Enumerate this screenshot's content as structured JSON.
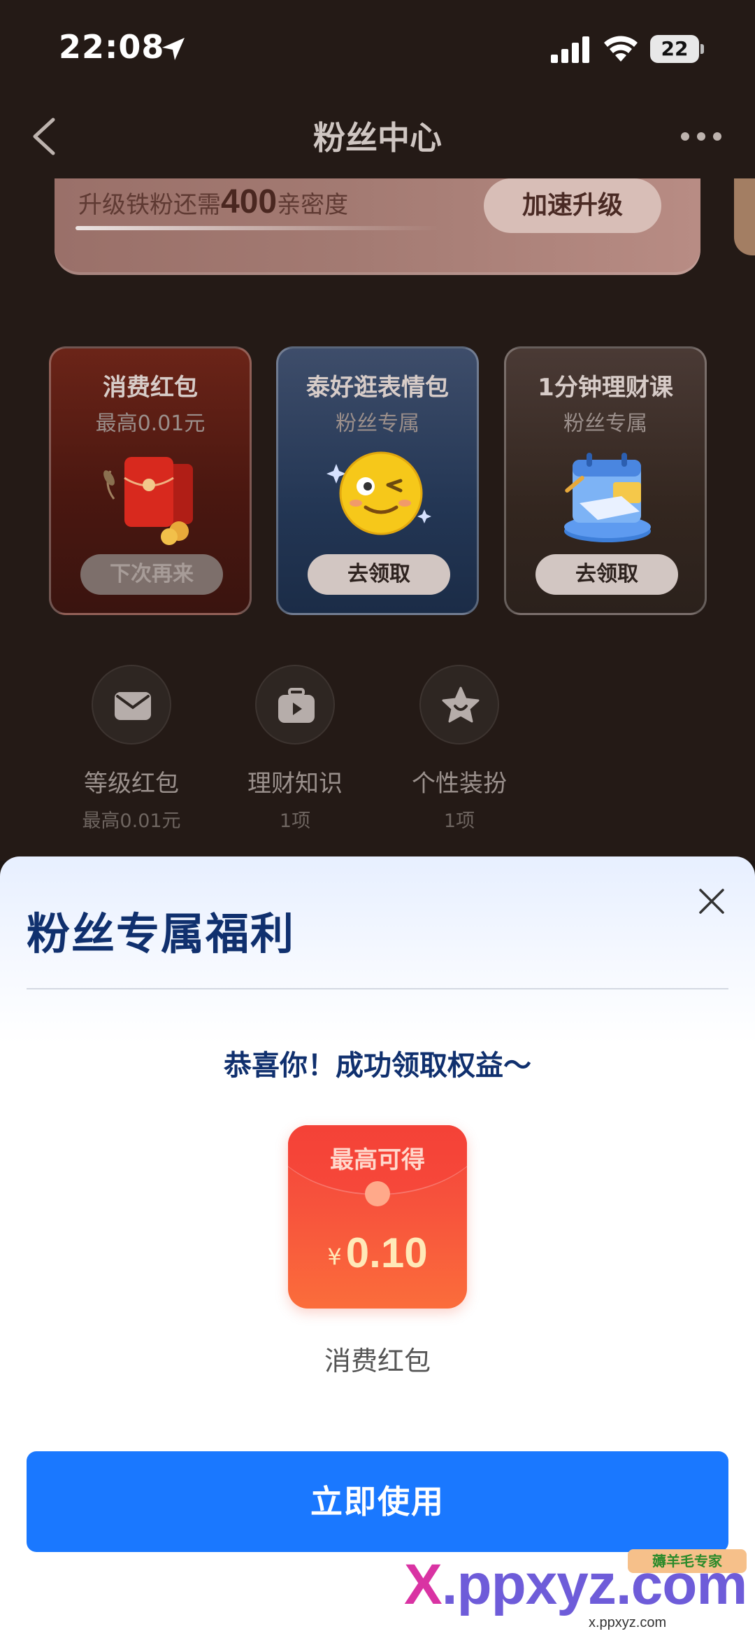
{
  "status_bar": {
    "time": "22:08",
    "battery": "22"
  },
  "nav": {
    "title": "粉丝中心"
  },
  "upgrade": {
    "prefix": "升级铁粉还需",
    "amount": "400",
    "suffix": "亲密度",
    "button": "加速升级"
  },
  "benefits": [
    {
      "title": "消费红包",
      "subtitle": "最高0.01元",
      "button": "下次再来",
      "state": "disabled",
      "icon": "red-envelope-icon"
    },
    {
      "title": "泰好逛表情包",
      "subtitle": "粉丝专属",
      "button": "去领取",
      "state": "active",
      "icon": "wink-emoji-icon"
    },
    {
      "title": "1分钟理财课",
      "subtitle": "粉丝专属",
      "button": "去领取",
      "state": "active",
      "icon": "calendar-course-icon"
    }
  ],
  "quick_links": [
    {
      "label": "等级红包",
      "sub": "最高0.01元",
      "icon": "envelope-icon"
    },
    {
      "label": "理财知识",
      "sub": "1项",
      "icon": "video-briefcase-icon"
    },
    {
      "label": "个性装扮",
      "sub": "1项",
      "icon": "star-face-icon"
    }
  ],
  "sheet": {
    "title": "粉丝专属福利",
    "success": "恭喜你！成功领取权益～",
    "packet_label": "最高可得",
    "packet_currency": "¥",
    "packet_amount": "0.10",
    "packet_name": "消费红包",
    "use_button": "立即使用"
  },
  "watermark": {
    "text_x": "X",
    "text_rest": ".ppxyz.com",
    "badge": "薅羊毛专家",
    "bottom": "x.ppxyz.com"
  },
  "colors": {
    "primary_button": "#1a78ff",
    "sheet_title": "#10306e",
    "red_packet": "#f6483a"
  }
}
